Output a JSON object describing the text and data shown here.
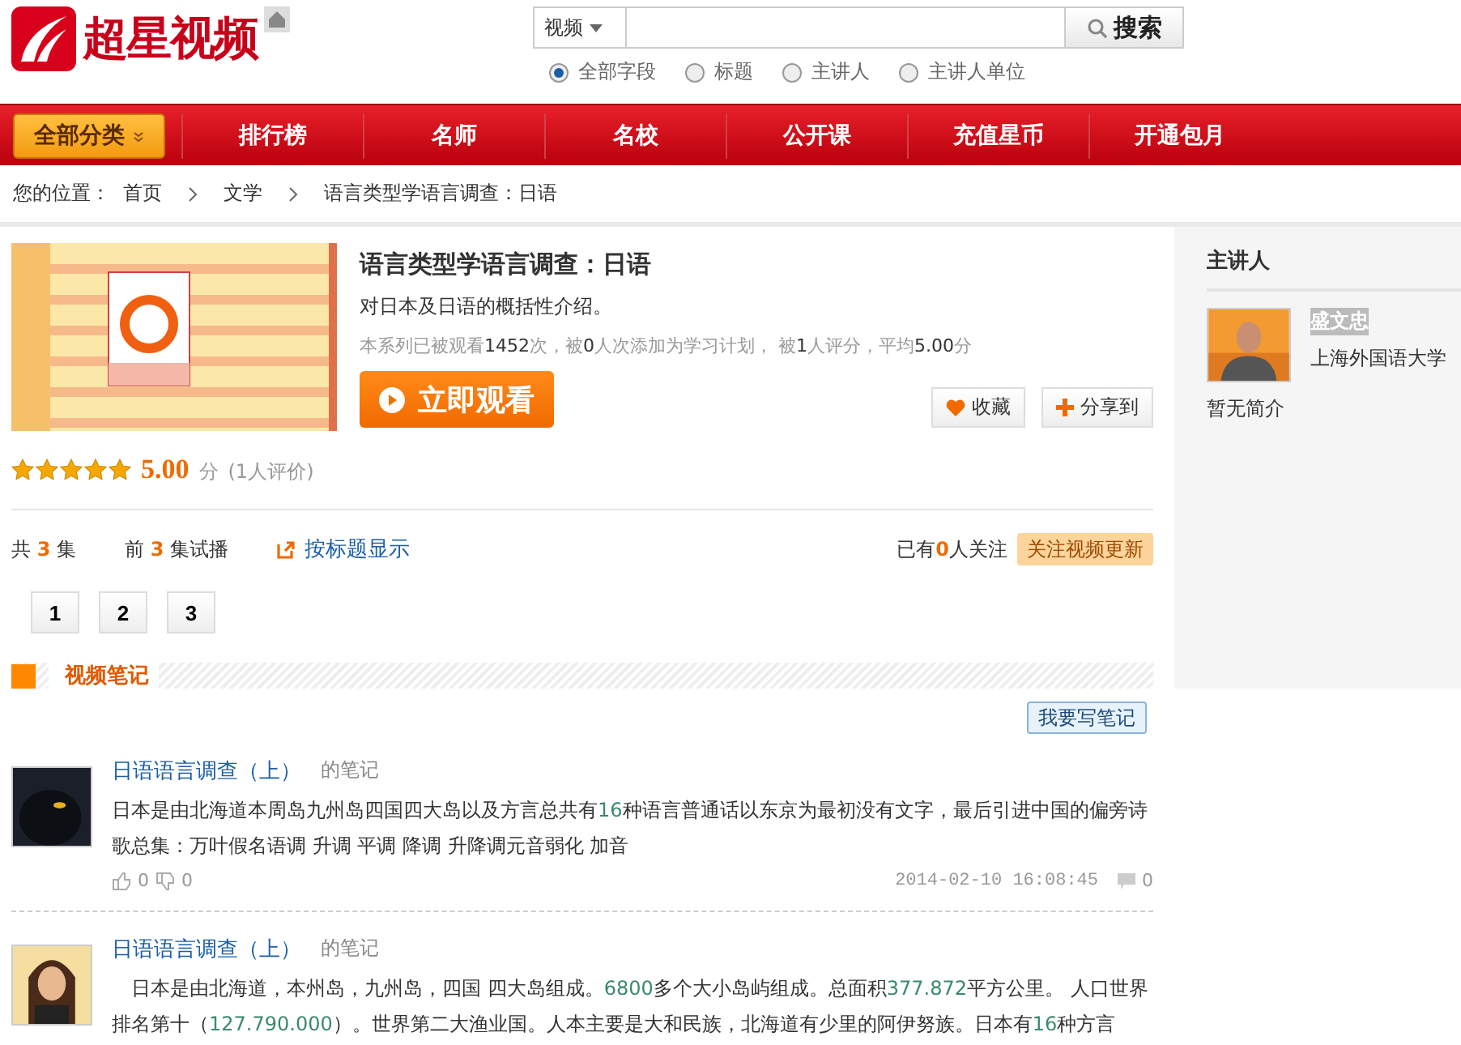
{
  "header": {
    "logo_text": "超星视频",
    "search": {
      "scope": "视频",
      "button": "搜索"
    },
    "search_fields": [
      {
        "label": "全部字段",
        "selected": true
      },
      {
        "label": "标题",
        "selected": false
      },
      {
        "label": "主讲人",
        "selected": false
      },
      {
        "label": "主讲人单位",
        "selected": false
      }
    ]
  },
  "nav": {
    "all_button": "全部分类",
    "items": [
      "排行榜",
      "名师",
      "名校",
      "公开课",
      "充值星币",
      "开通包月"
    ]
  },
  "breadcrumb": {
    "prefix": "您的位置：",
    "items": [
      "首页",
      "文学",
      "语言类型学语言调查：日语"
    ]
  },
  "course": {
    "title": "语言类型学语言调查：日语",
    "description": "对日本及日语的概括性介绍。",
    "stats": "本系列已被观看**1452**次，被**0**人次添加为学习计划，  被**1**人评分，平均**5.00**分",
    "watch_button": "立即观看",
    "favorite_button": "收藏",
    "share_button": "分享到",
    "stars": 5,
    "score": "5.00",
    "score_unit": "分",
    "rating_count": "(1人评价)"
  },
  "episodes": {
    "total": "共 **3** 集",
    "trial": "前 **3** 集试播",
    "title_view_link": "按标题显示",
    "followers": "已有**0**人关注",
    "follow_button": "关注视频更新",
    "pages": [
      {
        "label": "1"
      },
      {
        "label": "2"
      },
      {
        "label": "3"
      }
    ]
  },
  "notes": {
    "heading": "视频笔记",
    "write_button": "我要写笔记",
    "items": [
      {
        "link": "日语语言调查（上）",
        "suffix": "的笔记",
        "body": "日本是由北海道本周岛九州岛四国四大岛以及方言总共有**16**种语言普通话以东京为最初没有文字，最后引进中国的偏旁诗歌总集：万叶假名语调 升调 平调 降调 升降调元音弱化 加音",
        "likes": "0",
        "dislikes": "0",
        "time": "2014-02-10 16:08:45",
        "comments": "0"
      },
      {
        "link": "日语语言调查（上）",
        "suffix": "的笔记",
        "body": "　日本是由北海道，本州岛，九州岛，四国 四大岛组成。**6800**多个大小岛屿组成。总面积**377.872**平方公里。 人口世界排名第十（**127.790.000**）。世界第二大渔业国。人本主要是大和民族，北海道有少里的阿伊努族。日本有**16**种方言"
      }
    ]
  },
  "sidebar": {
    "heading": "主讲人",
    "lecturer": {
      "name": "盛文忠",
      "affiliation": "上海外国语大学"
    },
    "bio": "暂无简介"
  }
}
